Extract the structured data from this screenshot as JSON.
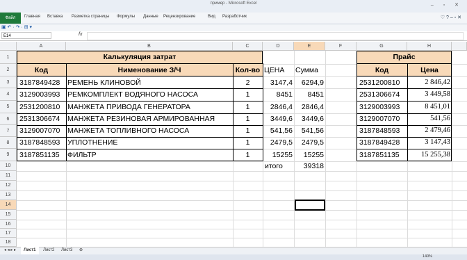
{
  "window": {
    "title": "пример - Microsoft Excel",
    "controls": "– ▫ ✕"
  },
  "ribbon": {
    "file_tab": "Файл",
    "tabs": [
      "Главная",
      "Вставка",
      "Разметка страницы",
      "Формулы",
      "Данные",
      "Рецензирование",
      "Вид",
      "Разработчик"
    ],
    "help_icons": "♡ ? – ▫ ✕"
  },
  "quick_access": "▣ ↶ · ↷ · ⊞ ▾",
  "formula_bar": {
    "name_box": "E14",
    "fx": "fx",
    "value": ""
  },
  "columns": [
    "A",
    "B",
    "C",
    "D",
    "E",
    "F",
    "G",
    "H"
  ],
  "rows": [
    "1",
    "2",
    "3",
    "4",
    "5",
    "6",
    "7",
    "8",
    "9",
    "10",
    "11",
    "12",
    "13",
    "14",
    "15",
    "16",
    "17",
    "18"
  ],
  "calc": {
    "title": "Калькуляция затрат",
    "headers": {
      "code": "Код",
      "name": "Нименование З/Ч",
      "qty": "Кол-во",
      "price": "ЦЕНА",
      "sum": "Сумма"
    },
    "items": [
      {
        "code": "3187849428",
        "name": "РЕМЕНЬ КЛИНОВОЙ",
        "qty": "2",
        "price": "3147,4",
        "sum": "6294,9"
      },
      {
        "code": "3129003993",
        "name": "РЕМКОМПЛЕКТ ВОДЯНОГО НАСОСА",
        "qty": "1",
        "price": "8451",
        "sum": "8451"
      },
      {
        "code": "2531200810",
        "name": "МАНЖЕТА ПРИВОДА ГЕНЕРАТОРА",
        "qty": "1",
        "price": "2846,4",
        "sum": "2846,4"
      },
      {
        "code": "2531306674",
        "name": "МАНЖЕТА РЕЗИНОВАЯ АРМИРОВАННАЯ",
        "qty": "1",
        "price": "3449,6",
        "sum": "3449,6"
      },
      {
        "code": "3129007070",
        "name": "МАНЖЕТА ТОПЛИВНОГО НАСОСА",
        "qty": "1",
        "price": "541,56",
        "sum": "541,56"
      },
      {
        "code": "3187848593",
        "name": "УПЛОТНЕНИЕ",
        "qty": "1",
        "price": "2479,5",
        "sum": "2479,5"
      },
      {
        "code": "3187851135",
        "name": "ФИЛЬТР",
        "qty": "1",
        "price": "15255",
        "sum": "15255"
      }
    ],
    "total_label": "итого",
    "total_value": "39318"
  },
  "price_list": {
    "title": "Прайс",
    "headers": {
      "code": "Код",
      "price": "Цена"
    },
    "items": [
      {
        "code": "2531200810",
        "price": "2 846,42"
      },
      {
        "code": "2531306674",
        "price": "3 449,58"
      },
      {
        "code": "3129003993",
        "price": "8 451,01"
      },
      {
        "code": "3129007070",
        "price": "541,56"
      },
      {
        "code": "3187848593",
        "price": "2 479,46"
      },
      {
        "code": "3187849428",
        "price": "3 147,43"
      },
      {
        "code": "3187851135",
        "price": "15 255,38"
      }
    ]
  },
  "sheets": [
    "Лист1",
    "Лист2",
    "Лист3"
  ],
  "status": {
    "zoom": "140%"
  }
}
